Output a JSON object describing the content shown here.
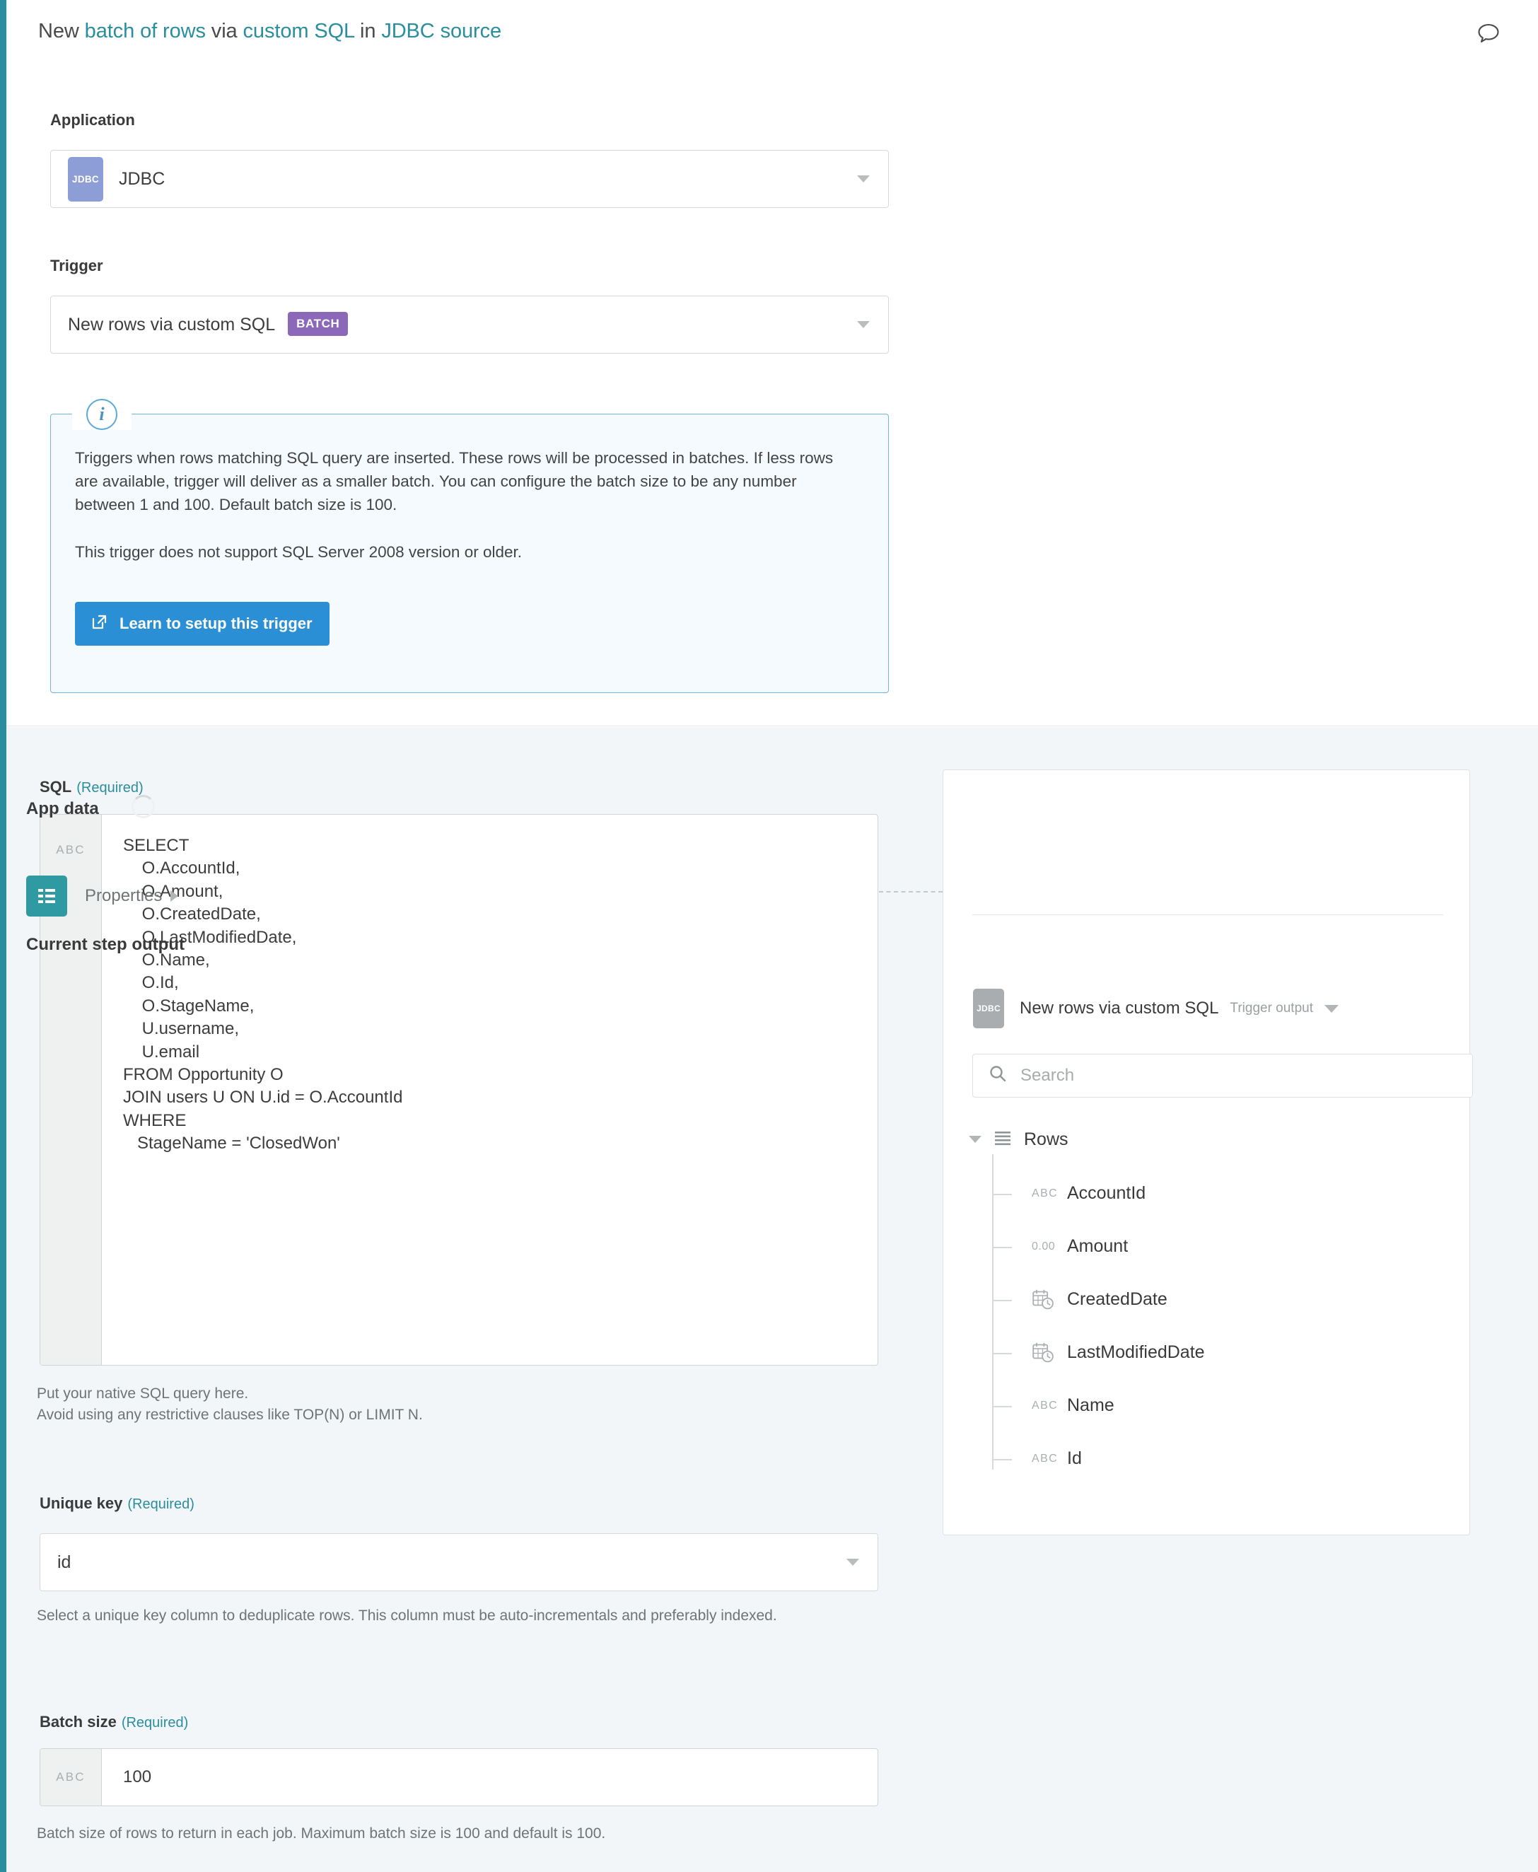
{
  "header": {
    "title_parts": [
      {
        "text": "New ",
        "accent": false
      },
      {
        "text": "batch of rows",
        "accent": true
      },
      {
        "text": " via ",
        "accent": false
      },
      {
        "text": "custom SQL",
        "accent": true
      },
      {
        "text": " in ",
        "accent": false
      },
      {
        "text": "JDBC source",
        "accent": true
      }
    ],
    "title_plain": "New batch of rows via custom SQL in JDBC source",
    "comment_icon": "comment-icon"
  },
  "application": {
    "label": "Application",
    "value": "JDBC",
    "icon_text": "JDBC"
  },
  "trigger": {
    "label": "Trigger",
    "value": "New rows via custom SQL",
    "badge": "BATCH"
  },
  "info": {
    "icon": "info-icon",
    "paragraph1": "Triggers when rows matching SQL query are inserted. These rows will be processed in batches. If less rows are available, trigger will deliver as a smaller batch. You can configure the batch size to be any number between 1 and 100. Default batch size is 100.",
    "paragraph2": "This trigger does not support SQL Server 2008 version or older.",
    "button_label": "Learn to setup this trigger",
    "button_icon": "external-link-icon",
    "button_color": "#2a8fd4"
  },
  "sql": {
    "label": "SQL",
    "required": "(Required)",
    "gutter_type": "ABC",
    "value": "SELECT\n    O.AccountId,\n    O.Amount,\n    O.CreatedDate,\n    O.LastModifiedDate,\n    O.Name,\n    O.Id,\n    O.StageName,\n    U.username,\n    U.email\nFROM Opportunity O\nJOIN users U ON U.id = O.AccountId\nWHERE\n   StageName = 'ClosedWon'",
    "help": "Put your native SQL query here.\nAvoid using any restrictive clauses like TOP(N) or LIMIT N."
  },
  "unique_key": {
    "label": "Unique key",
    "required": "(Required)",
    "value": "id",
    "help": "Select a unique key column to deduplicate rows. This column must be auto-incrementals and preferably indexed."
  },
  "batch_size": {
    "label": "Batch size",
    "required": "(Required)",
    "gutter_type": "ABC",
    "value": "100",
    "help": "Batch size of rows to return in each job. Maximum batch size is 100 and default is 100."
  },
  "right_panel": {
    "app_data_title": "App data",
    "spinner": "loading-spinner",
    "properties_label": "Properties",
    "properties_icon": "list-icon",
    "current_step_title": "Current step output",
    "step": {
      "icon_text": "JDBC",
      "name": "New rows via custom SQL",
      "subtitle": "Trigger output"
    },
    "search": {
      "placeholder": "Search",
      "value": "",
      "icon": "search-icon"
    },
    "tree": {
      "root_label": "Rows",
      "root_icon": "rows-icon",
      "items": [
        {
          "label": "AccountId",
          "type": "ABC",
          "type_kind": "string"
        },
        {
          "label": "Amount",
          "type": "0.00",
          "type_kind": "number"
        },
        {
          "label": "CreatedDate",
          "type": "",
          "type_kind": "datetime"
        },
        {
          "label": "LastModifiedDate",
          "type": "",
          "type_kind": "datetime"
        },
        {
          "label": "Name",
          "type": "ABC",
          "type_kind": "string"
        },
        {
          "label": "Id",
          "type": "ABC",
          "type_kind": "string"
        }
      ]
    }
  },
  "colors": {
    "accent_teal": "#2a8e9e",
    "button_blue": "#2a8fd4",
    "badge_purple": "#8c69b8",
    "jdbc_purple": "#8d9ed6",
    "properties_teal": "#2f9aa2"
  }
}
